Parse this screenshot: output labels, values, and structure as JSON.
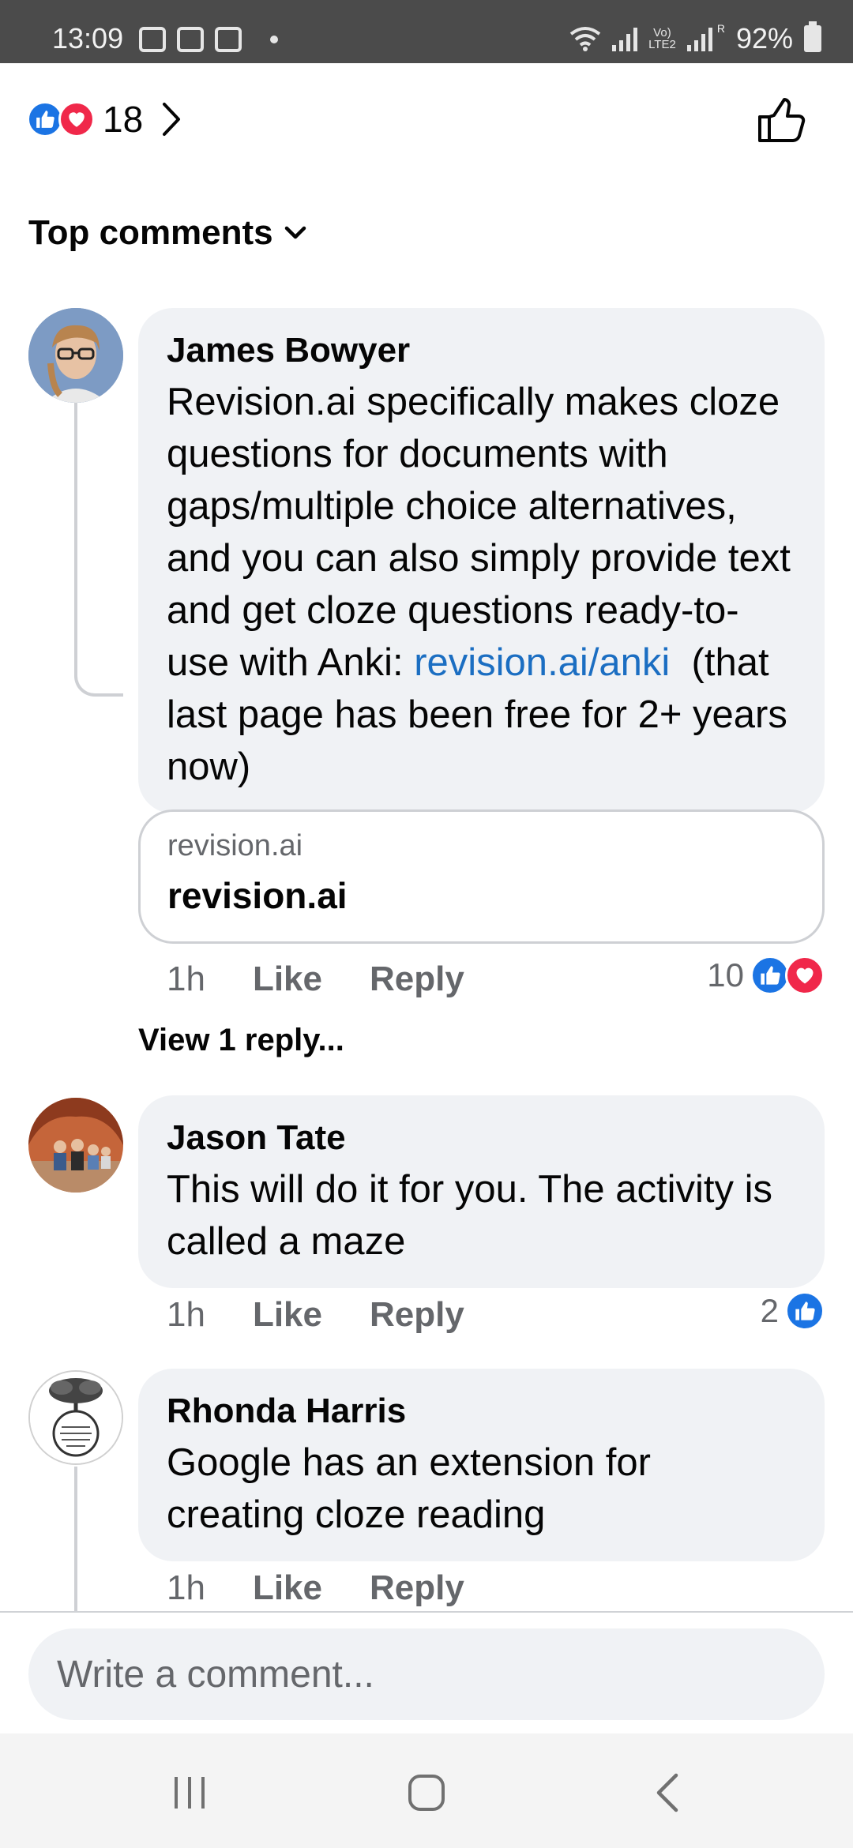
{
  "status_bar": {
    "time": "13:09",
    "volte_label_top": "Vo)",
    "volte_label_bottom": "LTE2",
    "signal_label": "R",
    "battery": "92%"
  },
  "reactions": {
    "count": "18",
    "icons": [
      "like-icon",
      "love-icon"
    ]
  },
  "sort": {
    "label": "Top comments"
  },
  "comments": [
    {
      "author": "James Bowyer",
      "text_before_link": "Revision.ai specifically makes cloze questions for documents with gaps/multiple choice alternatives, and you can also simply provide text and get cloze questions ready-to-use with Anki: ",
      "link": "revision.ai/anki",
      "text_after_link": "  (that last page has been free for 2+ years now)",
      "link_preview": {
        "domain": "revision.ai",
        "title": "revision.ai"
      },
      "time": "1h",
      "like_label": "Like",
      "reply_label": "Reply",
      "reaction_count": "10",
      "view_replies": "View 1 reply..."
    },
    {
      "author": "Jason Tate",
      "text": "This will do it for you. The activity is called a maze",
      "time": "1h",
      "like_label": "Like",
      "reply_label": "Reply",
      "reaction_count": "2"
    },
    {
      "author": "Rhonda Harris",
      "text": "Google has an extension for creating cloze reading",
      "time": "1h",
      "like_label": "Like",
      "reply_label": "Reply"
    }
  ],
  "composer": {
    "placeholder": "Write a comment..."
  },
  "colors": {
    "accent": "#1b74e4",
    "love": "#f0284a",
    "bubble": "#f0f2f5",
    "link": "#1b6ec2"
  }
}
